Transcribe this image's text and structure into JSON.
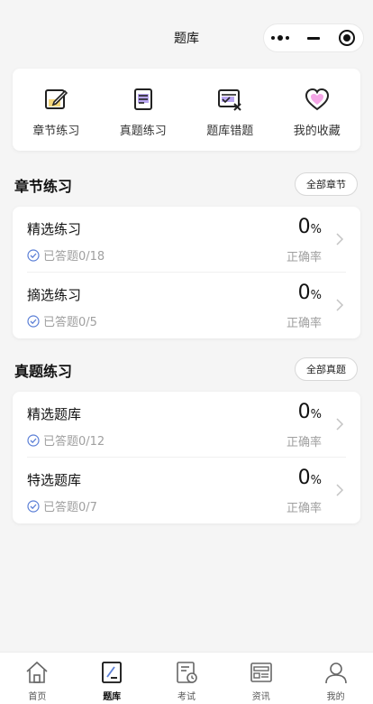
{
  "header": {
    "title": "题库"
  },
  "quick_nav": [
    {
      "label": "章节练习",
      "icon": "edit-note-icon"
    },
    {
      "label": "真题练习",
      "icon": "document-icon"
    },
    {
      "label": "题库错题",
      "icon": "wrong-questions-icon"
    },
    {
      "label": "我的收藏",
      "icon": "heart-icon"
    }
  ],
  "sections": [
    {
      "title": "章节练习",
      "button": "全部章节",
      "items": [
        {
          "name": "精选练习",
          "answered": "已答题0/18",
          "percent": "0",
          "unit": "%",
          "accuracy_label": "正确率"
        },
        {
          "name": "摘选练习",
          "answered": "已答题0/5",
          "percent": "0",
          "unit": "%",
          "accuracy_label": "正确率"
        }
      ]
    },
    {
      "title": "真题练习",
      "button": "全部真题",
      "items": [
        {
          "name": "精选题库",
          "answered": "已答题0/12",
          "percent": "0",
          "unit": "%",
          "accuracy_label": "正确率"
        },
        {
          "name": "特选题库",
          "answered": "已答题0/7",
          "percent": "0",
          "unit": "%",
          "accuracy_label": "正确率"
        }
      ]
    }
  ],
  "tabbar": [
    {
      "label": "首页",
      "icon": "home-icon",
      "active": false
    },
    {
      "label": "题库",
      "icon": "question-bank-icon",
      "active": true
    },
    {
      "label": "考试",
      "icon": "exam-icon",
      "active": false
    },
    {
      "label": "资讯",
      "icon": "news-icon",
      "active": false
    },
    {
      "label": "我的",
      "icon": "profile-icon",
      "active": false
    }
  ],
  "colors": {
    "accent_blue": "#5b7fd6",
    "heart_pink": "#f4a6e6",
    "highlight_purple": "#b9a6f2",
    "highlight_yellow": "#f5d77a"
  }
}
